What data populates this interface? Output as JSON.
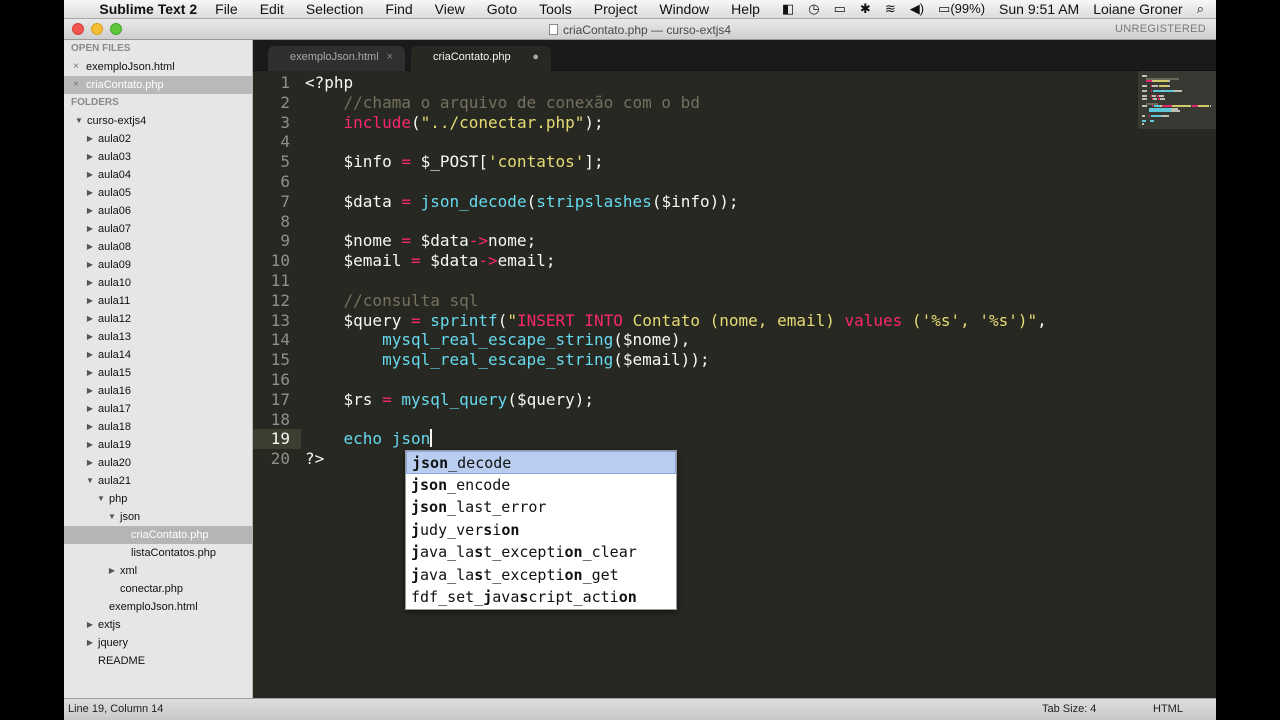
{
  "menubar": {
    "app": "Sublime Text 2",
    "menus": [
      "File",
      "Edit",
      "Selection",
      "Find",
      "View",
      "Goto",
      "Tools",
      "Project",
      "Window",
      "Help"
    ],
    "battery": "(99%)",
    "clock": "Sun 9:51 AM",
    "user": "Loiane Groner"
  },
  "window": {
    "title": "criaContato.php — curso-extjs4",
    "unregistered": "UNREGISTERED"
  },
  "sidebar": {
    "open_files_label": "OPEN FILES",
    "folders_label": "FOLDERS",
    "open_files": [
      {
        "name": "exemploJson.html",
        "selected": false
      },
      {
        "name": "criaContato.php",
        "selected": true
      }
    ],
    "tree": [
      {
        "name": "curso-extjs4",
        "depth": 0,
        "arrow": "down"
      },
      {
        "name": "aula02",
        "depth": 1,
        "arrow": "right"
      },
      {
        "name": "aula03",
        "depth": 1,
        "arrow": "right"
      },
      {
        "name": "aula04",
        "depth": 1,
        "arrow": "right"
      },
      {
        "name": "aula05",
        "depth": 1,
        "arrow": "right"
      },
      {
        "name": "aula06",
        "depth": 1,
        "arrow": "right"
      },
      {
        "name": "aula07",
        "depth": 1,
        "arrow": "right"
      },
      {
        "name": "aula08",
        "depth": 1,
        "arrow": "right"
      },
      {
        "name": "aula09",
        "depth": 1,
        "arrow": "right"
      },
      {
        "name": "aula10",
        "depth": 1,
        "arrow": "right"
      },
      {
        "name": "aula11",
        "depth": 1,
        "arrow": "right"
      },
      {
        "name": "aula12",
        "depth": 1,
        "arrow": "right"
      },
      {
        "name": "aula13",
        "depth": 1,
        "arrow": "right"
      },
      {
        "name": "aula14",
        "depth": 1,
        "arrow": "right"
      },
      {
        "name": "aula15",
        "depth": 1,
        "arrow": "right"
      },
      {
        "name": "aula16",
        "depth": 1,
        "arrow": "right"
      },
      {
        "name": "aula17",
        "depth": 1,
        "arrow": "right"
      },
      {
        "name": "aula18",
        "depth": 1,
        "arrow": "right"
      },
      {
        "name": "aula19",
        "depth": 1,
        "arrow": "right"
      },
      {
        "name": "aula20",
        "depth": 1,
        "arrow": "right"
      },
      {
        "name": "aula21",
        "depth": 1,
        "arrow": "down"
      },
      {
        "name": "php",
        "depth": 2,
        "arrow": "down"
      },
      {
        "name": "json",
        "depth": 3,
        "arrow": "down"
      },
      {
        "name": "criaContato.php",
        "depth": 4,
        "arrow": "",
        "selected": true
      },
      {
        "name": "listaContatos.php",
        "depth": 4,
        "arrow": ""
      },
      {
        "name": "xml",
        "depth": 3,
        "arrow": "right"
      },
      {
        "name": "conectar.php",
        "depth": 3,
        "arrow": ""
      },
      {
        "name": "exemploJson.html",
        "depth": 2,
        "arrow": ""
      },
      {
        "name": "extjs",
        "depth": 1,
        "arrow": "right"
      },
      {
        "name": "jquery",
        "depth": 1,
        "arrow": "right"
      },
      {
        "name": "README",
        "depth": 1,
        "arrow": ""
      }
    ]
  },
  "tabs": [
    {
      "label": "exemploJson.html",
      "active": false,
      "close": "×"
    },
    {
      "label": "criaContato.php",
      "active": true,
      "close": "●"
    }
  ],
  "editor": {
    "current_line": 19,
    "lines": [
      [
        [
          "<?php",
          ""
        ]
      ],
      [
        [
          "    ",
          ""
        ],
        [
          "//chama o arquivo de conexão com o bd",
          "cm"
        ]
      ],
      [
        [
          "    ",
          ""
        ],
        [
          "include",
          "kw"
        ],
        [
          "(",
          ""
        ],
        [
          "\"../conectar.php\"",
          "str"
        ],
        [
          ");",
          ""
        ]
      ],
      [],
      [
        [
          "    $info ",
          ""
        ],
        [
          "=",
          "kw"
        ],
        [
          " $_POST[",
          ""
        ],
        [
          "'contatos'",
          "str"
        ],
        [
          "];",
          ""
        ]
      ],
      [],
      [
        [
          "    $data ",
          ""
        ],
        [
          "=",
          "kw"
        ],
        [
          " ",
          ""
        ],
        [
          "json_decode",
          "fn"
        ],
        [
          "(",
          ""
        ],
        [
          "stripslashes",
          "fn"
        ],
        [
          "($info));",
          ""
        ]
      ],
      [],
      [
        [
          "    $nome ",
          ""
        ],
        [
          "=",
          "kw"
        ],
        [
          " $data",
          ""
        ],
        [
          "->",
          "kw"
        ],
        [
          "nome;",
          ""
        ]
      ],
      [
        [
          "    $email ",
          ""
        ],
        [
          "=",
          "kw"
        ],
        [
          " $data",
          ""
        ],
        [
          "->",
          "kw"
        ],
        [
          "email;",
          ""
        ]
      ],
      [],
      [
        [
          "    ",
          ""
        ],
        [
          "//consulta sql",
          "cm"
        ]
      ],
      [
        [
          "    $query ",
          ""
        ],
        [
          "=",
          "kw"
        ],
        [
          " ",
          ""
        ],
        [
          "sprintf",
          "fn"
        ],
        [
          "(",
          ""
        ],
        [
          "\"",
          "str"
        ],
        [
          "INSERT INTO",
          "kw"
        ],
        [
          " Contato (nome, email) ",
          "str"
        ],
        [
          "values",
          "kw"
        ],
        [
          " ('%s', '%s')\"",
          "str"
        ],
        [
          ",",
          ""
        ]
      ],
      [
        [
          "        ",
          ""
        ],
        [
          "mysql_real_escape_string",
          "fn"
        ],
        [
          "($nome),",
          ""
        ]
      ],
      [
        [
          "        ",
          ""
        ],
        [
          "mysql_real_escape_string",
          "fn"
        ],
        [
          "($email));",
          ""
        ]
      ],
      [],
      [
        [
          "    $rs ",
          ""
        ],
        [
          "=",
          "kw"
        ],
        [
          " ",
          ""
        ],
        [
          "mysql_query",
          "fn"
        ],
        [
          "($query);",
          ""
        ]
      ],
      [],
      [
        [
          "    echo ",
          "fn"
        ],
        [
          "json",
          "fn"
        ],
        [
          "|cursor|",
          ""
        ]
      ],
      [
        [
          "?>",
          ""
        ]
      ]
    ]
  },
  "autocomplete": [
    [
      [
        "json",
        "b"
      ],
      [
        "_decode",
        ""
      ]
    ],
    [
      [
        "json",
        "b"
      ],
      [
        "_encode",
        ""
      ]
    ],
    [
      [
        "json",
        "b"
      ],
      [
        "_last_error",
        ""
      ]
    ],
    [
      [
        "j",
        "b"
      ],
      [
        "udy_ver",
        ""
      ],
      [
        "s",
        "b"
      ],
      [
        "i",
        ""
      ],
      [
        "on",
        "b"
      ]
    ],
    [
      [
        "j",
        "b"
      ],
      [
        "ava_la",
        ""
      ],
      [
        "s",
        "b"
      ],
      [
        "t_excepti",
        ""
      ],
      [
        "on",
        "b"
      ],
      [
        "_clear",
        ""
      ]
    ],
    [
      [
        "j",
        "b"
      ],
      [
        "ava_la",
        ""
      ],
      [
        "s",
        "b"
      ],
      [
        "t_excepti",
        ""
      ],
      [
        "on",
        "b"
      ],
      [
        "_get",
        ""
      ]
    ],
    [
      [
        "fdf_set_",
        ""
      ],
      [
        "j",
        "b"
      ],
      [
        "ava",
        ""
      ],
      [
        "s",
        "b"
      ],
      [
        "cript_acti",
        ""
      ],
      [
        "on",
        "b"
      ]
    ]
  ],
  "status": {
    "position": "Line 19, Column 14",
    "tab_size": "Tab Size: 4",
    "syntax": "HTML"
  },
  "colors": {
    "editor_bg": "#272822",
    "keyword": "#f92672",
    "function": "#66d9ef",
    "string": "#e6db74",
    "comment": "#75715e"
  }
}
